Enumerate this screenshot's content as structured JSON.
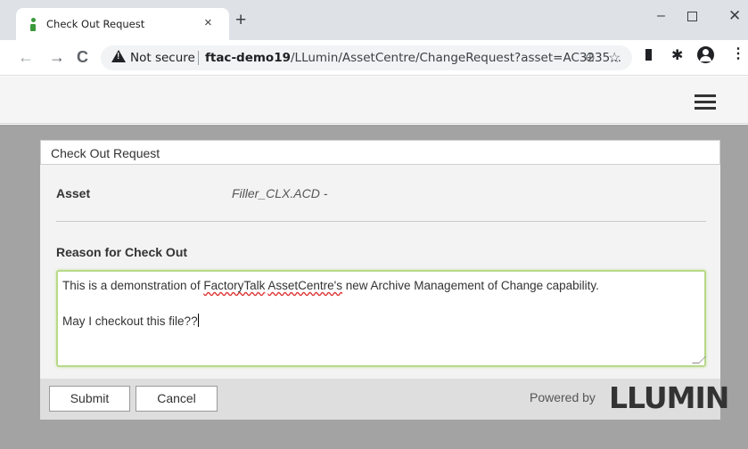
{
  "browser": {
    "tab_title": "Check Out Request",
    "tab_close": "×",
    "new_tab": "+",
    "security_label": "Not secure",
    "url_host": "ftac-demo19",
    "url_path": "/LLumin/AssetCentre/ChangeRequest?asset=AC3235...",
    "window_controls": {
      "minimize": "–",
      "close": "✕"
    }
  },
  "dialog": {
    "title": "Check Out Request",
    "asset_label": "Asset",
    "asset_value": "Filler_CLX.ACD -",
    "reason_label": "Reason for Check Out",
    "reason_line1_prefix": "This is a demonstration of ",
    "reason_word_factorytalk": "FactoryTalk",
    "reason_space": " ",
    "reason_word_assetcentre": "AssetCentre's",
    "reason_line1_suffix": " new Archive Management of Change capability.",
    "reason_line2": "May I checkout this file??",
    "submit_label": "Submit",
    "cancel_label": "Cancel",
    "powered_by": "Powered by",
    "brand": "LLUMIN"
  },
  "colors": {
    "accent_green": "#7bb32e",
    "overlay_gray": "#a3a3a3",
    "textarea_focus_border": "#b8d98a"
  },
  "icons": [
    "favicon-icon",
    "back-arrow-icon",
    "forward-arrow-icon",
    "reload-icon",
    "warning-icon",
    "zoom-icon",
    "star-icon",
    "extension-icon",
    "puzzle-icon",
    "profile-icon",
    "more-menu-icon",
    "hamburger-menu-icon",
    "resize-grip-icon"
  ]
}
